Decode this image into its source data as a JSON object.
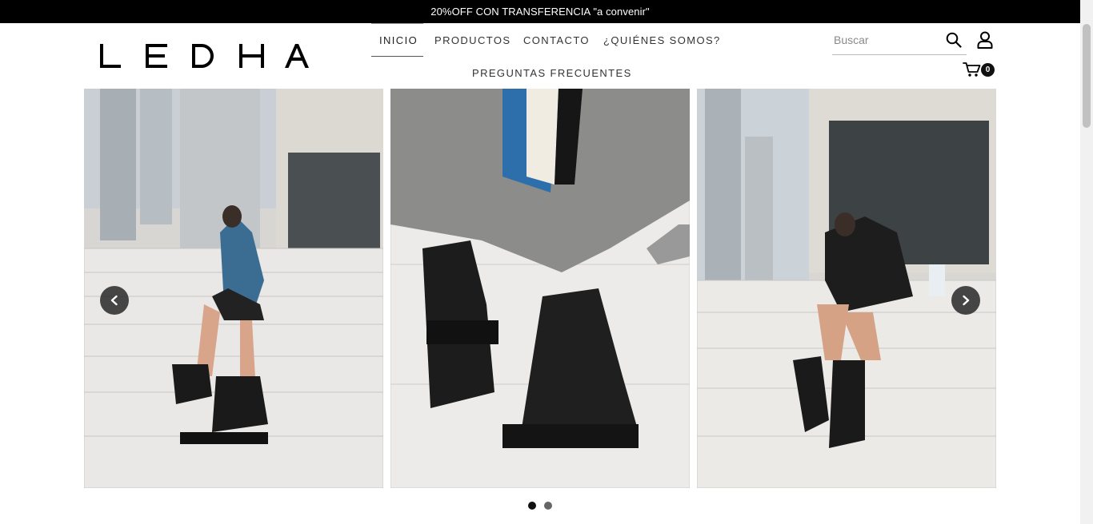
{
  "announcement": "20%OFF CON TRANSFERENCIA \"a convenir\"",
  "brand": {
    "letters": [
      "L",
      "E",
      "D",
      "H",
      "A"
    ]
  },
  "nav": {
    "inicio": "INICIO",
    "productos": "PRODUCTOS",
    "contacto": "CONTACTO",
    "quienes": "¿QUIÉNES SOMOS?",
    "faq": "PREGUNTAS FRECUENTES"
  },
  "search": {
    "placeholder": "Buscar"
  },
  "cart": {
    "count": "0"
  },
  "icons": {
    "search": "search-icon",
    "user": "user-icon",
    "cart": "cart-icon",
    "prev": "chevron-left-icon",
    "next": "chevron-right-icon"
  },
  "carousel": {
    "slides": 3,
    "pages": 2,
    "current_page": 1
  },
  "colors": {
    "announce_bg": "#000000",
    "text": "#333333"
  }
}
